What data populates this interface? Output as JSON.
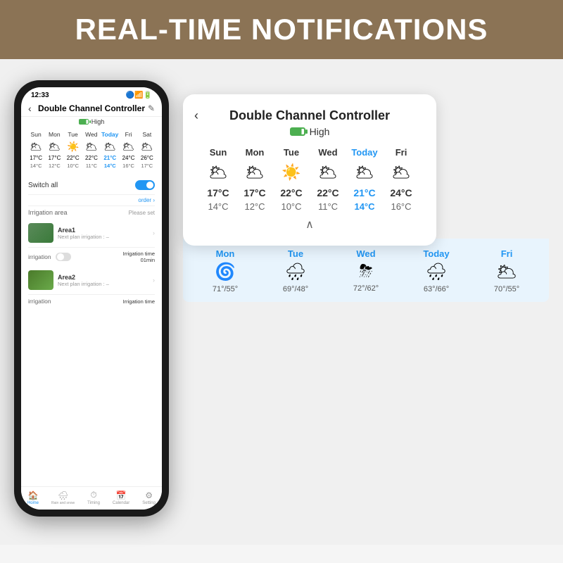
{
  "header": {
    "title": "REAL-TIME NOTIFICATIONS"
  },
  "phone": {
    "status_time": "12:33",
    "title": "Double Channel Controller",
    "back_icon": "‹",
    "edit_icon": "✎",
    "signal_label": "High",
    "weather": {
      "days": [
        "Sun",
        "Mon",
        "Tue",
        "Wed",
        "Today",
        "Fri",
        "Sat"
      ],
      "icons": [
        "☁",
        "☁",
        "☀",
        "☁",
        "☁",
        "☁",
        "☁"
      ],
      "high_temps": [
        "17°C",
        "17°C",
        "22°C",
        "22°C",
        "21°C",
        "24°C",
        "26°C"
      ],
      "low_temps": [
        "14°C",
        "12°C",
        "10°C",
        "11°C",
        "14°C",
        "16°C",
        "17°C"
      ]
    },
    "switch_all": "Switch all",
    "order": "order",
    "irrigation_area": "Irrigation area",
    "please_set": "Please set",
    "areas": [
      {
        "name": "Area1",
        "sub": "Next plan irrigation : –"
      },
      {
        "name": "Area2",
        "sub": "Next plan irrigation : –"
      }
    ],
    "irrigation_label": "irrigation",
    "irrigation_time_label": "Irrigation time",
    "irrigation_time_value": "01min",
    "nav": [
      "Home",
      "Rain and snow days delay",
      "Timing",
      "Calendar",
      "Setting"
    ]
  },
  "popup": {
    "back_icon": "‹",
    "title": "Double Channel Controller",
    "signal_label": "High",
    "weather": {
      "days": [
        "Sun",
        "Mon",
        "Tue",
        "Wed",
        "Today",
        "Fri"
      ],
      "icons": [
        "☁",
        "☁",
        "☀",
        "☁",
        "☁",
        "☁"
      ],
      "high_temps": [
        "17°C",
        "17°C",
        "22°C",
        "22°C",
        "21°C",
        "24°C"
      ],
      "low_temps": [
        "14°C",
        "12°C",
        "10°C",
        "11°C",
        "14°C",
        "16°C"
      ]
    },
    "chevron": "∧"
  },
  "forecast": {
    "items": [
      {
        "day": "Mon",
        "icon": "🌀",
        "temp": "71°/55°"
      },
      {
        "day": "Tue",
        "icon": "🌧",
        "temp": "69°/48°"
      },
      {
        "day": "Wed",
        "icon": "⛈",
        "temp": "72°/62°"
      },
      {
        "day": "Today",
        "icon": "🌧",
        "temp": "63°/66°"
      },
      {
        "day": "Fri",
        "icon": "🌥",
        "temp": "70°/55°"
      }
    ]
  }
}
